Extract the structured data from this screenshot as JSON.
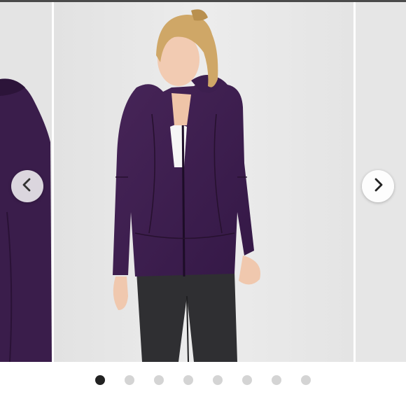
{
  "carousel": {
    "slide_count": 8,
    "active_index": 0,
    "prev_icon": "chevron-left-icon",
    "next_icon": "chevron-right-icon"
  },
  "colors": {
    "jacket_purple": "#3d1f4f",
    "pants_charcoal": "#2e2e30",
    "backdrop_gray": "#e8e8e8",
    "active_dot": "#222222",
    "inactive_dot": "#d4d4d4"
  }
}
